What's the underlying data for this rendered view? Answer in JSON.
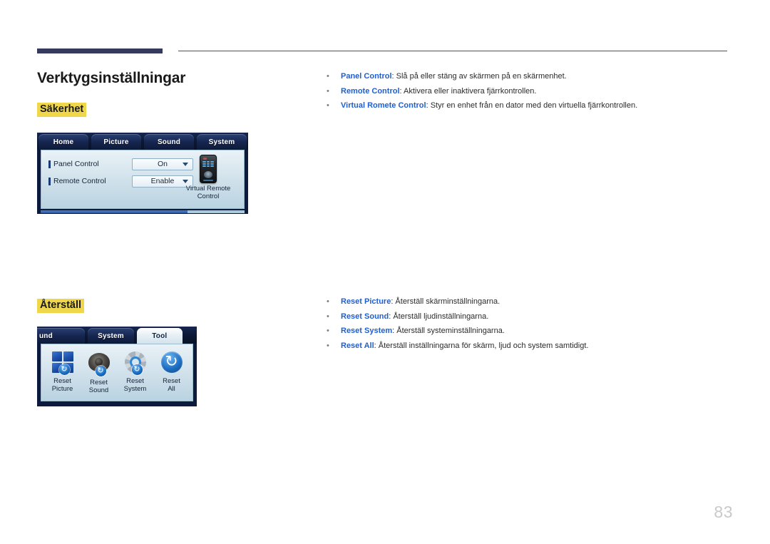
{
  "page": {
    "title": "Verktygsinställningar",
    "number": "83"
  },
  "sections": [
    {
      "heading": "Säkerhet",
      "bullets": [
        {
          "term": "Panel Control",
          "desc": ": Slå på eller stäng av skärmen på en skärmenhet."
        },
        {
          "term": "Remote Control",
          "desc": ": Aktivera eller inaktivera fjärrkontrollen."
        },
        {
          "term": "Virtual Romete Control",
          "desc": ": Styr en enhet från en dator med den virtuella fjärrkontrollen."
        }
      ]
    },
    {
      "heading": "Återställ",
      "bullets": [
        {
          "term": "Reset Picture",
          "desc": ": Återställ skärminställningarna."
        },
        {
          "term": "Reset Sound",
          "desc": ": Återställ ljudinställningarna."
        },
        {
          "term": "Reset System",
          "desc": ": Återställ systeminställningarna."
        },
        {
          "term": "Reset All",
          "desc": ": Återställ inställningarna för skärm, ljud och system samtidigt."
        }
      ]
    }
  ],
  "screenshot_security": {
    "tabs": [
      {
        "label": "Home",
        "active": false
      },
      {
        "label": "Picture",
        "active": false
      },
      {
        "label": "Sound",
        "active": false
      },
      {
        "label": "System",
        "active": false
      }
    ],
    "rows": [
      {
        "label": "Panel Control",
        "value": "On"
      },
      {
        "label": "Remote Control",
        "value": "Enable"
      }
    ],
    "virtual_remote": {
      "line1": "Virtual Remote",
      "line2": "Control"
    }
  },
  "screenshot_reset": {
    "tabs": [
      {
        "label": "und",
        "active": false
      },
      {
        "label": "System",
        "active": false
      },
      {
        "label": "Tool",
        "active": true
      }
    ],
    "icons": [
      {
        "caption_line1": "Reset",
        "caption_line2": "Picture",
        "icon": "window-grid-icon"
      },
      {
        "caption_line1": "Reset",
        "caption_line2": "Sound",
        "icon": "speaker-icon"
      },
      {
        "caption_line1": "Reset",
        "caption_line2": "System",
        "icon": "gear-icon"
      },
      {
        "caption_line1": "Reset",
        "caption_line2": "All",
        "icon": "refresh-icon"
      }
    ]
  },
  "colors": {
    "rule": "#363b5e",
    "highlight": "#efd64b",
    "term": "#1f5fd0",
    "panel_chrome": "#0b1a3d"
  }
}
